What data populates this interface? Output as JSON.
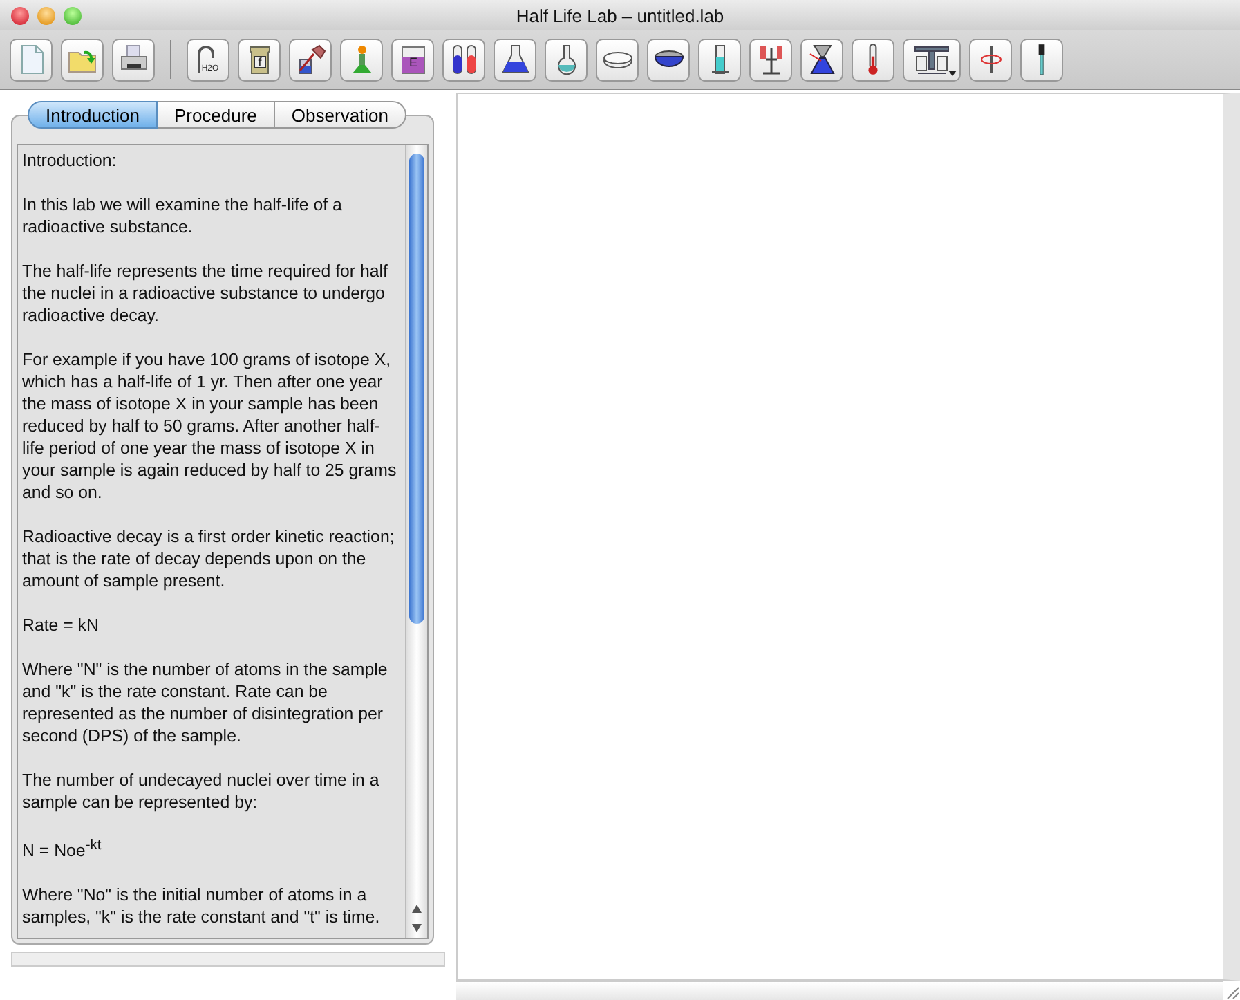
{
  "window": {
    "title": "Half Life Lab – untitled.lab"
  },
  "toolbar": {
    "groups": [
      [
        {
          "kind": "document"
        },
        {
          "kind": "folder"
        },
        {
          "kind": "printer"
        }
      ],
      [
        {
          "kind": "faucet",
          "label": "H2O"
        },
        {
          "kind": "jar",
          "label": "f"
        },
        {
          "kind": "pour"
        },
        {
          "kind": "burner"
        },
        {
          "kind": "beaker",
          "label": "E"
        },
        {
          "kind": "tubes"
        },
        {
          "kind": "flask"
        },
        {
          "kind": "roundflask"
        },
        {
          "kind": "dish"
        },
        {
          "kind": "bowl"
        },
        {
          "kind": "cylinder"
        },
        {
          "kind": "stand"
        },
        {
          "kind": "funnel"
        },
        {
          "kind": "thermometer"
        },
        {
          "kind": "balance",
          "menu": true
        },
        {
          "kind": "stirrer"
        },
        {
          "kind": "dropper"
        }
      ]
    ]
  },
  "tabs": [
    {
      "label": "Introduction",
      "selected": true
    },
    {
      "label": "Procedure",
      "selected": false
    },
    {
      "label": "Observation",
      "selected": false
    }
  ],
  "paragraphs": [
    "Introduction:",
    "In this lab we will examine the half-life of a radioactive substance.",
    "The half-life represents the time required for half the nuclei in a radioactive substance to undergo radioactive decay.",
    "For example if you have 100 grams of isotope X, which has a half-life of 1 yr. Then after one year the mass of isotope X in your sample has been reduced by half to 50 grams.  After another half-life period of one year the mass of isotope X in your sample is again reduced by half to 25 grams and so on.",
    "Radioactive decay is a first order kinetic reaction; that is the rate of decay depends upon on the amount of sample present.",
    "Rate = kN",
    "Where \"N\" is the number of atoms in the sample and \"k\" is the rate constant. Rate can be represented as the number of disintegration per second (DPS) of the sample.",
    "The number of undecayed nuclei over time in a sample can be represented by:",
    "N = Noe$^{-kt}$",
    "Where \"No\" is the initial number of atoms in a samples, \"k\" is the rate constant and \"t\" is time."
  ]
}
